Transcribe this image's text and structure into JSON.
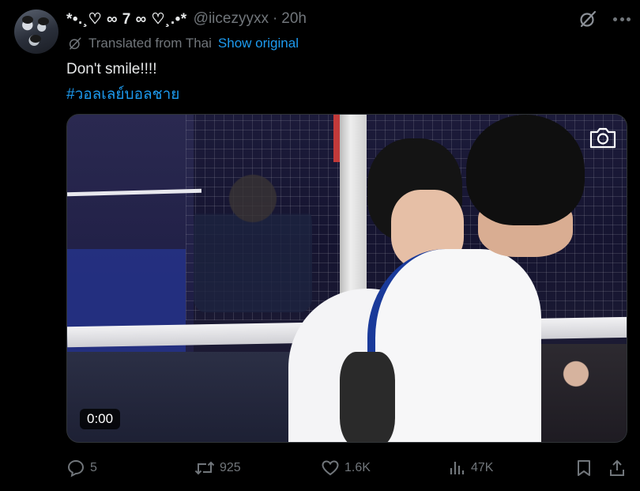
{
  "author": {
    "display_name": "*•.¸♡ ∞ 7 ∞ ♡¸.•*",
    "handle": "@iicezyyxx",
    "separator": "·",
    "time": "20h"
  },
  "translation": {
    "label": "Translated from Thai",
    "show_original": "Show original"
  },
  "tweet": {
    "text": "Don't smile!!!!",
    "hashtag": "#วอลเลย์บอลชาย"
  },
  "media": {
    "duration": "0:00"
  },
  "actions": {
    "replies": "5",
    "retweets": "925",
    "likes": "1.6K",
    "views": "47K"
  },
  "colors": {
    "background": "#000000",
    "text": "#e7e9ea",
    "muted": "#71767b",
    "accent": "#1d9bf0"
  },
  "icons": [
    "grok-icon",
    "more-icon",
    "translate-icon",
    "camera-icon",
    "reply-icon",
    "retweet-icon",
    "like-icon",
    "views-icon",
    "bookmark-icon",
    "share-icon"
  ]
}
